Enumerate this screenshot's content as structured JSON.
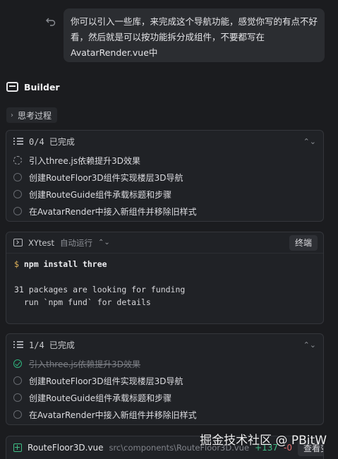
{
  "user_message": {
    "text": "你可以引入一些库，来完成这个导航功能，感觉你写的有点不好看，然后就是可以按功能拆分成组件，不要都写在AvatarRender.vue中"
  },
  "builder": {
    "name": "Builder"
  },
  "thinking": {
    "label": "思考过程"
  },
  "todo_card_1": {
    "status": "0/4 已完成",
    "tasks": [
      {
        "label": "引入three.js依赖提升3D效果",
        "state": "in-progress"
      },
      {
        "label": "创建RouteFloor3D组件实现楼层3D导航",
        "state": "pending"
      },
      {
        "label": "创建RouteGuide组件承载标题和步骤",
        "state": "pending"
      },
      {
        "label": "在AvatarRender中接入新组件并移除旧样式",
        "state": "pending"
      }
    ]
  },
  "terminal": {
    "name": "XYtest",
    "mode": "自动运行",
    "stop_label": "终端",
    "prompt": "$",
    "command": "npm install three",
    "output_line1": "31 packages are looking for funding",
    "output_line2": "  run `npm fund` for details"
  },
  "todo_card_2": {
    "status": "1/4 已完成",
    "tasks": [
      {
        "label": "引入three.js依赖提升3D效果",
        "state": "done"
      },
      {
        "label": "创建RouteFloor3D组件实现楼层3D导航",
        "state": "pending"
      },
      {
        "label": "创建RouteGuide组件承载标题和步骤",
        "state": "pending"
      },
      {
        "label": "在AvatarRender中接入新组件并移除旧样式",
        "state": "pending"
      }
    ]
  },
  "file_change": {
    "name": "RouteFloor3D.vue",
    "path": "src\\components\\RouteFloor3D.vue",
    "additions": "+137",
    "deletions": "-0",
    "view_label": "查看变更"
  },
  "watermark": "掘金技术社区 @ PBitW",
  "colors": {
    "accent_green": "#3fbf86",
    "background": "#1b1c1f",
    "card": "#202226"
  }
}
